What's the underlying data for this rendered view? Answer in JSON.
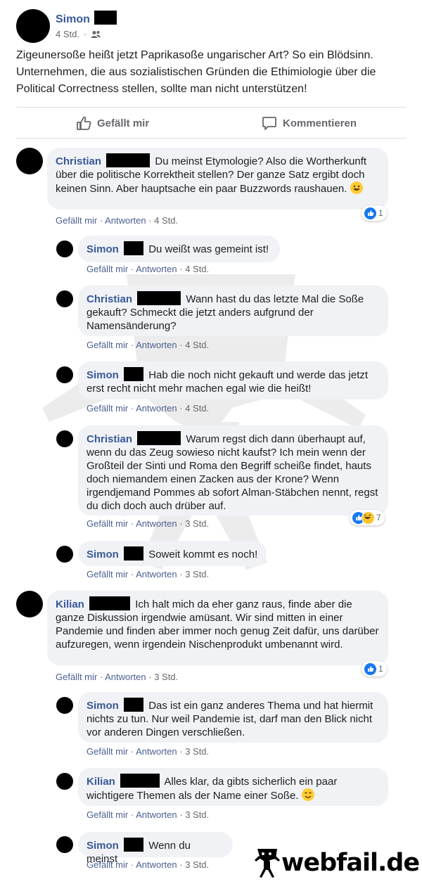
{
  "post": {
    "author": "Simon",
    "time": "4 Std.",
    "audience_icon": "friends-icon",
    "text": "Zigeunersoße heißt jetzt Paprikasoße ungarischer Art? So ein Blödsinn. Unternehmen, die aus sozialistischen Gründen die Ethimiologie über die Political Correctness stellen, sollte man nicht unterstützen!",
    "like_label": "Gefällt mir",
    "comment_label": "Kommentieren"
  },
  "meta": {
    "like": "Gefällt mir",
    "reply": "Antworten",
    "sep": " · "
  },
  "comments": [
    {
      "author": "Christian",
      "text": "Du meinst Etymologie? Also die Wortherkunft über die politische Korrektheit stellen? Der ganze Satz ergibt doch keinen Sinn. Aber hauptsache ein paar Buzzwords raushauen.",
      "time": "4 Std.",
      "reactions": "1"
    },
    {
      "author": "Simon",
      "text": "Du weißt was gemeint ist!",
      "time": "4 Std."
    },
    {
      "author": "Christian",
      "text": "Wann hast du das letzte Mal die Soße gekauft? Schmeckt die jetzt anders aufgrund der Namensänderung?",
      "time": "4 Std."
    },
    {
      "author": "Simon",
      "text": "Hab die noch nicht gekauft und werde das jetzt erst recht nicht mehr machen egal wie die heißt!",
      "time": "4 Std."
    },
    {
      "author": "Christian",
      "text": "Warum regst dich dann überhaupt auf, wenn du das Zeug sowieso nicht kaufst? Ich mein wenn der Großteil der Sinti und Roma den Begriff scheiße findet, hauts doch niemandem einen Zacken aus der Krone? Wenn irgendjemand Pommes ab sofort Alman-Stäbchen nennt, regst du dich doch auch drüber auf.",
      "time": "3 Std.",
      "reactions": "7"
    },
    {
      "author": "Simon",
      "text": "Soweit kommt es noch!",
      "time": "3 Std."
    },
    {
      "author": "Kilian",
      "text": "Ich halt mich da eher ganz raus, finde aber die ganze Diskussion irgendwie amüsant. Wir sind mitten in einer Pandemie und finden aber immer noch genug Zeit dafür, uns darüber aufzuregen, wenn irgendein Nischenprodukt umbenannt wird.",
      "time": "3 Std.",
      "reactions": "1"
    },
    {
      "author": "Simon",
      "text": "Das ist ein ganz anderes Thema und hat hiermit nichts zu tun. Nur weil Pandemie ist, darf man den Blick nicht vor anderen Dingen verschließen.",
      "time": "3 Std."
    },
    {
      "author": "Kilian",
      "text": "Alles klar, da gibts sicherlich ein paar wichtigere Themen als der Name einer Soße.",
      "time": "3 Std."
    },
    {
      "author": "Simon",
      "text": "Wenn du meinst",
      "time": "3 Std."
    }
  ],
  "watermark": {
    "text": "webfail.de"
  }
}
